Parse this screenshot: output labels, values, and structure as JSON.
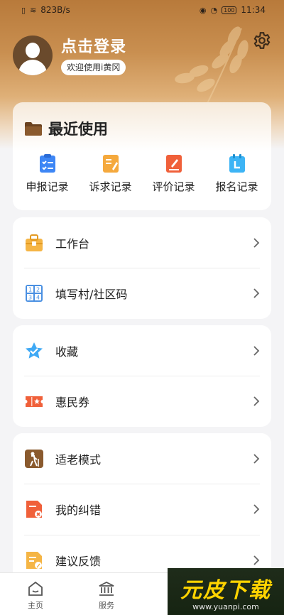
{
  "status_bar": {
    "network_speed": "823B/s",
    "battery": "100",
    "time": "11:34"
  },
  "profile": {
    "login_title": "点击登录",
    "welcome_text": "欢迎使用i黄冈"
  },
  "recent": {
    "title": "最近使用",
    "items": [
      {
        "label": "申报记录",
        "icon": "declaration-record-icon",
        "color": "#3d86f5"
      },
      {
        "label": "诉求记录",
        "icon": "appeal-record-icon",
        "color": "#f5a93d"
      },
      {
        "label": "评价记录",
        "icon": "evaluation-record-icon",
        "color": "#f0603a"
      },
      {
        "label": "报名记录",
        "icon": "signup-record-icon",
        "color": "#3db4f5"
      }
    ]
  },
  "menu_group1": [
    {
      "label": "工作台",
      "icon": "workbench-icon"
    },
    {
      "label": "填写村/社区码",
      "icon": "community-code-icon"
    }
  ],
  "menu_group2": [
    {
      "label": "收藏",
      "icon": "favorite-icon"
    },
    {
      "label": "惠民券",
      "icon": "coupon-icon"
    }
  ],
  "menu_group3": [
    {
      "label": "适老模式",
      "icon": "elderly-mode-icon"
    },
    {
      "label": "我的纠错",
      "icon": "correction-icon"
    },
    {
      "label": "建议反馈",
      "icon": "feedback-icon"
    }
  ],
  "tabbar": [
    {
      "label": "主页",
      "icon": "home-icon"
    },
    {
      "label": "服务",
      "icon": "service-icon"
    }
  ],
  "watermark": {
    "title": "元皮下载",
    "url": "www.yuanpi.com"
  }
}
